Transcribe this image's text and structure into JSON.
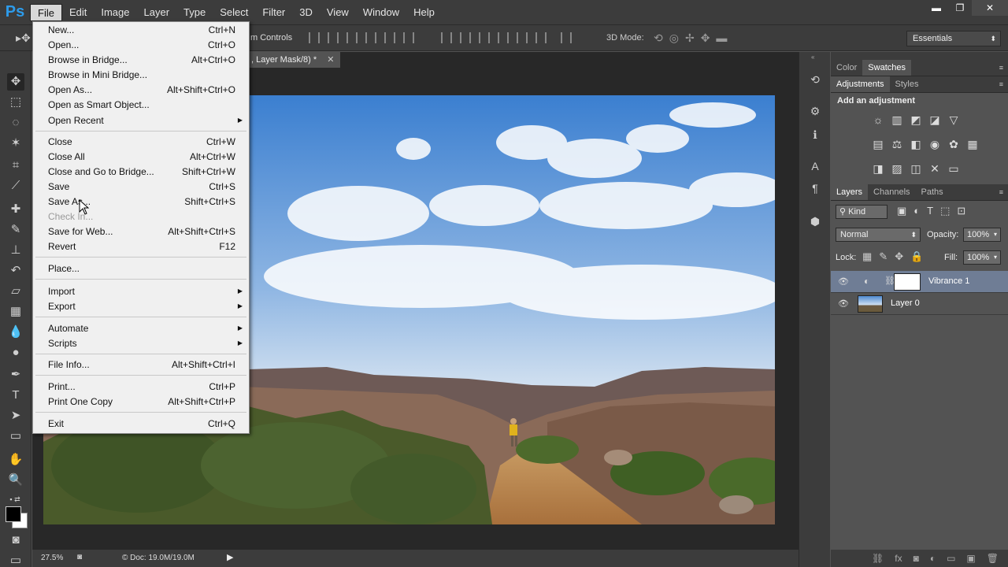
{
  "app": {
    "logo": "Ps",
    "menus": [
      "File",
      "Edit",
      "Image",
      "Layer",
      "Type",
      "Select",
      "Filter",
      "3D",
      "View",
      "Window",
      "Help"
    ],
    "window_controls": [
      "▬",
      "❐",
      "✕"
    ]
  },
  "options_bar": {
    "transform_controls_partial": "m Controls",
    "mode_3d_label": "3D Mode:",
    "workspace": "Essentials"
  },
  "document": {
    "tab_title": ", Layer Mask/8) *",
    "zoom": "27.5%",
    "doc_info": "© Doc: 19.0M/19.0M"
  },
  "file_menu": {
    "items": [
      {
        "label": "New...",
        "shortcut": "Ctrl+N"
      },
      {
        "label": "Open...",
        "shortcut": "Ctrl+O"
      },
      {
        "label": "Browse in Bridge...",
        "shortcut": "Alt+Ctrl+O"
      },
      {
        "label": "Browse in Mini Bridge...",
        "shortcut": ""
      },
      {
        "label": "Open As...",
        "shortcut": "Alt+Shift+Ctrl+O"
      },
      {
        "label": "Open as Smart Object...",
        "shortcut": ""
      },
      {
        "label": "Open Recent",
        "shortcut": ""
      },
      {
        "label": "Close",
        "shortcut": "Ctrl+W"
      },
      {
        "label": "Close All",
        "shortcut": "Alt+Ctrl+W"
      },
      {
        "label": "Close and Go to Bridge...",
        "shortcut": "Shift+Ctrl+W"
      },
      {
        "label": "Save",
        "shortcut": "Ctrl+S"
      },
      {
        "label": "Save As...",
        "shortcut": "Shift+Ctrl+S"
      },
      {
        "label": "Check In...",
        "shortcut": ""
      },
      {
        "label": "Save for Web...",
        "shortcut": "Alt+Shift+Ctrl+S"
      },
      {
        "label": "Revert",
        "shortcut": "F12"
      },
      {
        "label": "Place...",
        "shortcut": ""
      },
      {
        "label": "Import",
        "shortcut": ""
      },
      {
        "label": "Export",
        "shortcut": ""
      },
      {
        "label": "Automate",
        "shortcut": ""
      },
      {
        "label": "Scripts",
        "shortcut": ""
      },
      {
        "label": "File Info...",
        "shortcut": "Alt+Shift+Ctrl+I"
      },
      {
        "label": "Print...",
        "shortcut": "Ctrl+P"
      },
      {
        "label": "Print One Copy",
        "shortcut": "Alt+Shift+Ctrl+P"
      },
      {
        "label": "Exit",
        "shortcut": "Ctrl+Q"
      }
    ]
  },
  "panels": {
    "top_tabs": [
      "Color",
      "Swatches"
    ],
    "adj_tabs": [
      "Adjustments",
      "Styles"
    ],
    "adj_title": "Add an adjustment",
    "layer_tabs": [
      "Layers",
      "Channels",
      "Paths"
    ],
    "kind_filter": "Kind",
    "blend_mode": "Normal",
    "opacity_label": "Opacity:",
    "opacity_value": "100%",
    "lock_label": "Lock:",
    "fill_label": "Fill:",
    "fill_value": "100%",
    "layers": [
      {
        "name": "Vibrance 1",
        "selected": true
      },
      {
        "name": "Layer 0",
        "selected": false
      }
    ]
  },
  "colors": {
    "ps_blue": "#2d9bea",
    "layer_selected": "#6f7d95"
  }
}
